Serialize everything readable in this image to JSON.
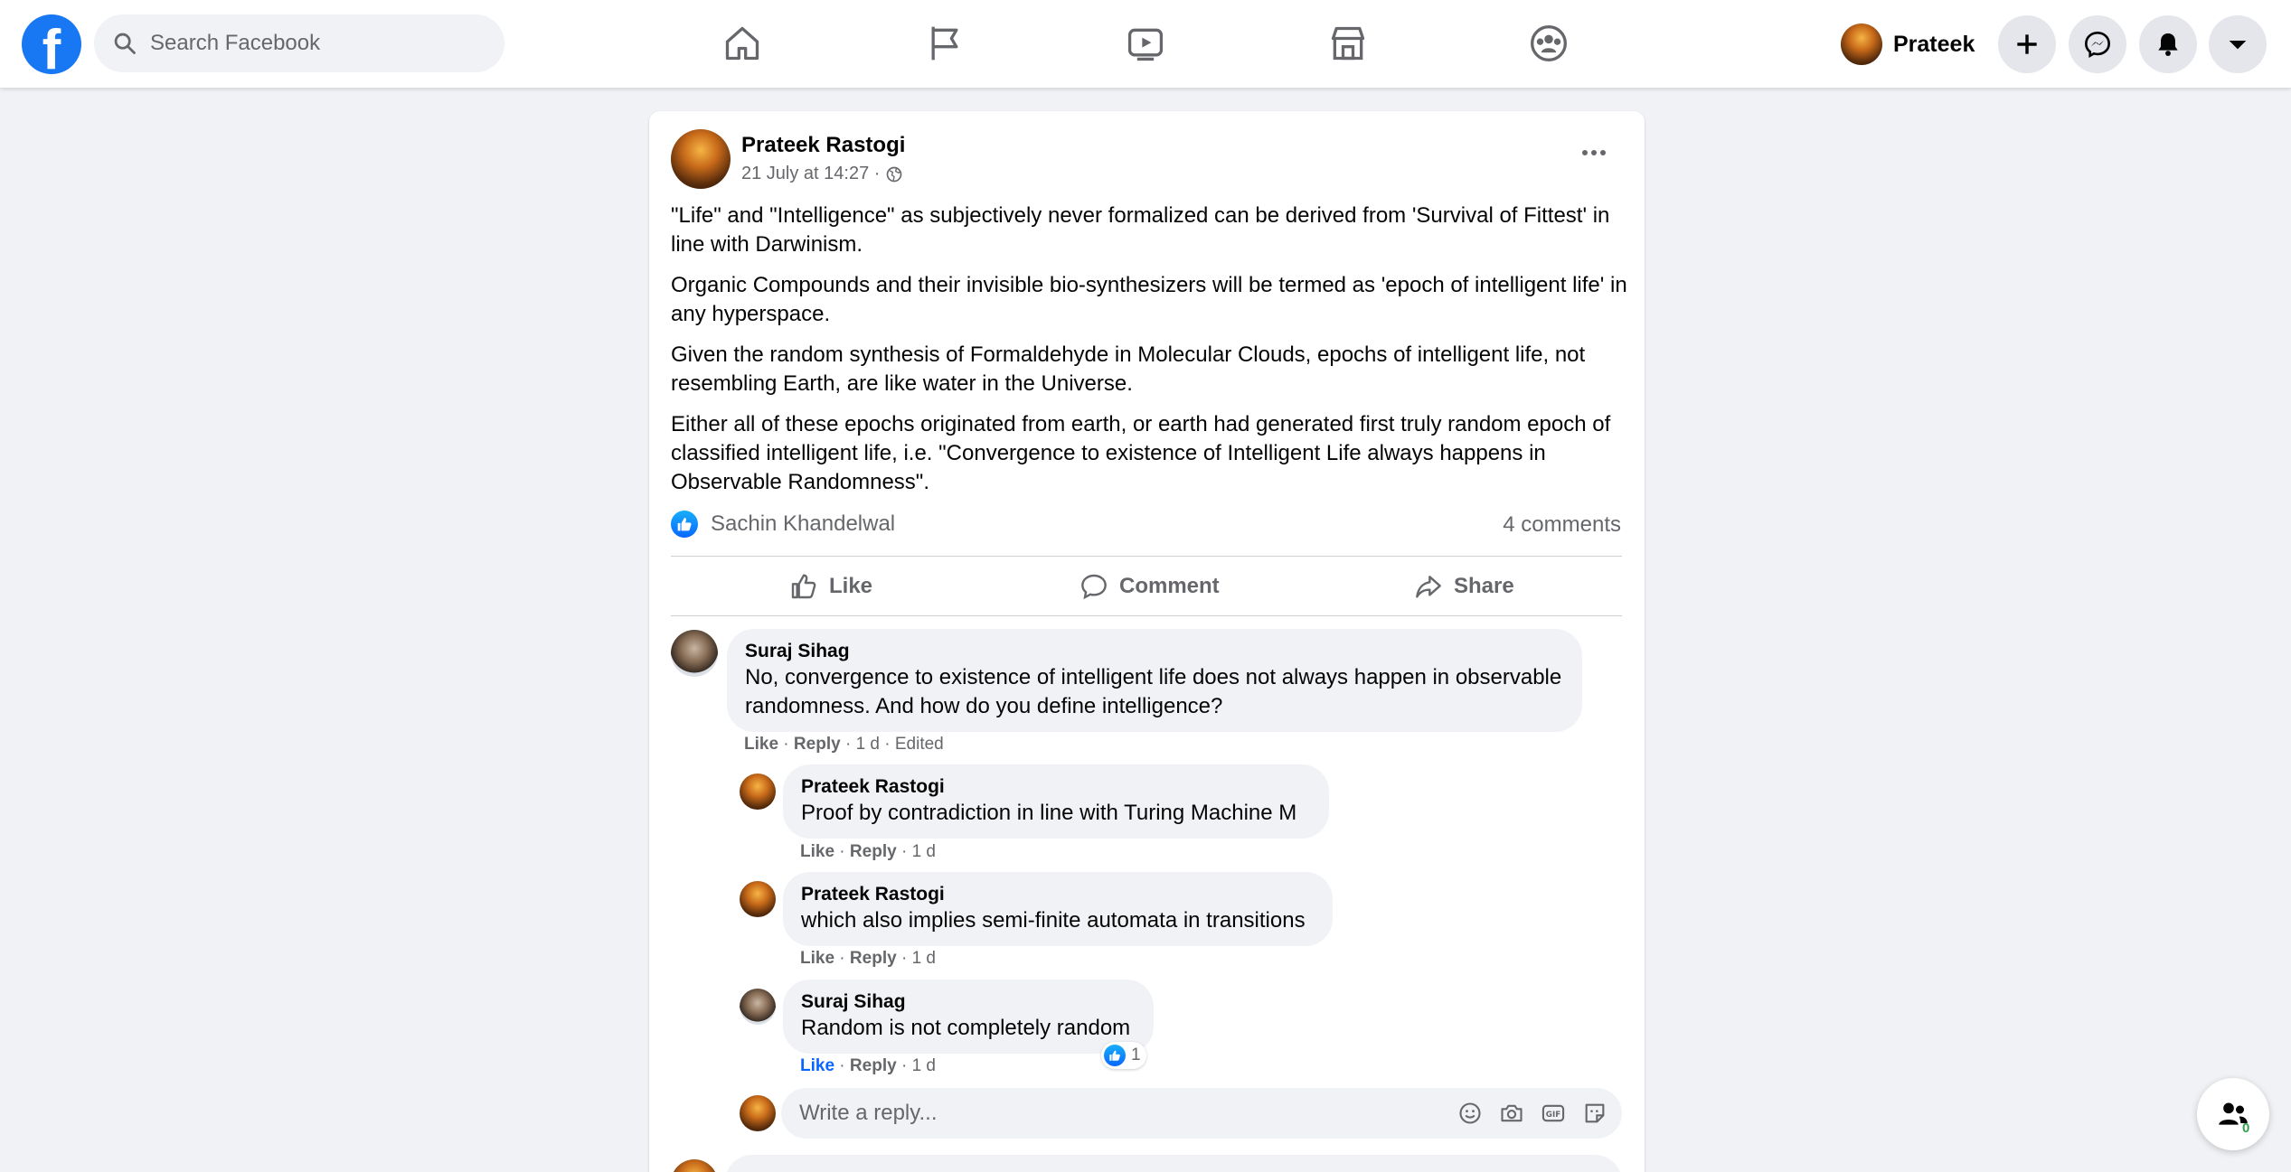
{
  "header": {
    "logo": "f",
    "search_placeholder": "Search Facebook",
    "profile_name": "Prateek",
    "nav_icons": [
      "home-icon",
      "pages-flag-icon",
      "watch-video-icon",
      "marketplace-icon",
      "groups-icon"
    ],
    "action_icons": [
      "create-plus-icon",
      "messenger-icon",
      "notifications-bell-icon",
      "account-menu-chevron-icon"
    ]
  },
  "post": {
    "author": "Prateek Rastogi",
    "timestamp": "21 July at 14:27 ·",
    "privacy_icon": "globe-icon",
    "paragraphs": [
      "\"Life\" and \"Intelligence\" as subjectively never formalized can be derived from 'Survival of Fittest' in line with Darwinism.",
      "Organic Compounds and their invisible bio-synthesizers will be termed as 'epoch of intelligent life' in any hyperspace.",
      "Given the random synthesis of Formaldehyde in Molecular Clouds, epochs of intelligent life, not resembling Earth, are like water in the Universe.",
      "Either all of these epochs originated from earth, or earth had generated first truly random epoch of classified intelligent life, i.e. \"Convergence to existence of Intelligent Life always happens in Observable Randomness\"."
    ],
    "reaction_names": "Sachin Khandelwal",
    "comment_count": "4 comments",
    "actions": {
      "like": "Like",
      "comment": "Comment",
      "share": "Share"
    }
  },
  "comments": [
    {
      "author": "Suraj Sihag",
      "text": "No, convergence to existence of intelligent life does not always happen in observable randomness. And how do you define intelligence?",
      "like": "Like",
      "reply": "Reply",
      "age": "1 d",
      "edited": "Edited"
    },
    {
      "author": "Prateek Rastogi",
      "text": "Proof by contradiction in line with Turing Machine M",
      "like": "Like",
      "reply": "Reply",
      "age": "1 d"
    },
    {
      "author": "Prateek Rastogi",
      "text": "which also implies semi-finite automata in transitions",
      "like": "Like",
      "reply": "Reply",
      "age": "1 d"
    },
    {
      "author": "Suraj Sihag",
      "text": "Random is not completely random",
      "like": "Like",
      "reply": "Reply",
      "age": "1 d",
      "reaction_count": "1"
    }
  ],
  "reply_box": {
    "placeholder": "Write a reply...",
    "icons": [
      "emoji-icon",
      "camera-icon",
      "gif-icon",
      "sticker-icon"
    ]
  },
  "floating_contacts": {
    "count": "0"
  },
  "colors": {
    "brand": "#1877f2",
    "like_blue": "#0866ff",
    "muted": "#65676b",
    "bg": "#f0f2f5"
  }
}
